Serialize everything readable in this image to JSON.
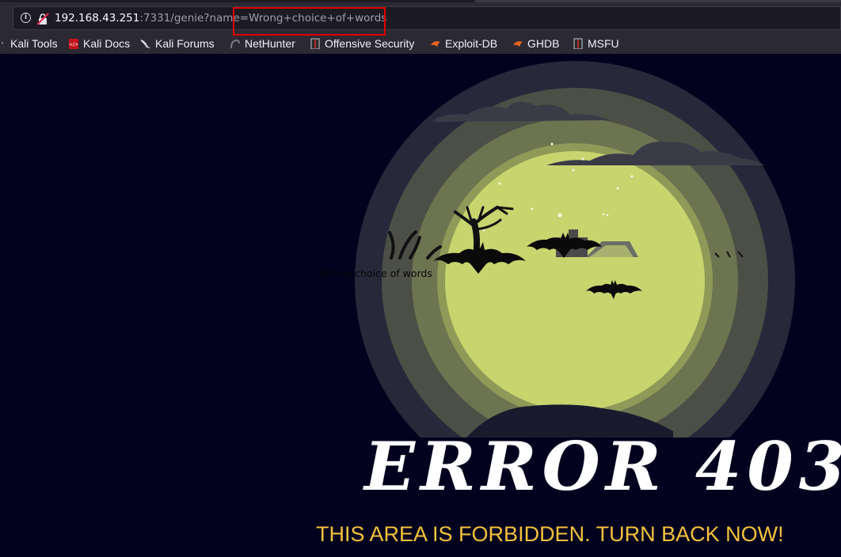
{
  "browser": {
    "url_host": "192.168.43.251",
    "url_rest": ":7331/genie?name=Wrong+choice+of+words",
    "bookmarks": [
      {
        "label": "Kali Tools",
        "icon": "kali-dragon-icon"
      },
      {
        "label": "Kali Docs",
        "icon": "kali-docs-icon"
      },
      {
        "label": "Kali Forums",
        "icon": "kali-dragon-icon"
      },
      {
        "label": "NetHunter",
        "icon": "nethunter-icon"
      },
      {
        "label": "Offensive Security",
        "icon": "offsec-icon"
      },
      {
        "label": "Exploit-DB",
        "icon": "exploit-db-icon"
      },
      {
        "label": "GHDB",
        "icon": "ghdb-icon"
      },
      {
        "label": "MSFU",
        "icon": "msfu-icon"
      }
    ]
  },
  "page": {
    "name_text": "Wrong choice of words",
    "error_title": "ERROR 403",
    "error_subtitle": "THIS AREA IS FORBIDDEN. TURN BACK NOW!"
  },
  "colors": {
    "background": "#02021e",
    "moon": "#c8d46e",
    "subtitle": "#f5c23b",
    "highlight": "#e00000"
  }
}
